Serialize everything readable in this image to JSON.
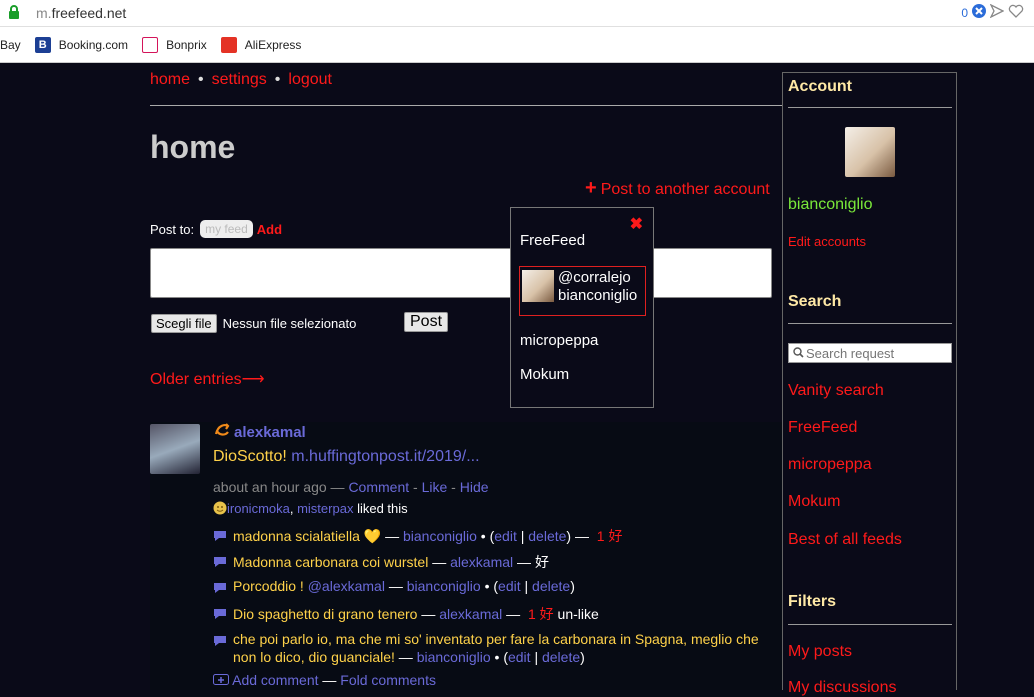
{
  "browser": {
    "url_domain": "m.freefeed.net",
    "url_prefix": "m.",
    "url_host": "freefeed.net",
    "badge_count": "0",
    "bookmarks": [
      {
        "label": "Bay",
        "color": ""
      },
      {
        "label": "Booking.com",
        "color": "#1c3f94"
      },
      {
        "label": "Bonprix",
        "color": "#d4145a"
      },
      {
        "label": "AliExpress",
        "color": "#e43225"
      }
    ]
  },
  "nav": {
    "home": "home",
    "settings": "settings",
    "logout": "logout",
    "sep": "•"
  },
  "page": {
    "title": "home",
    "post_another": "Post to another account",
    "post_to_label": "Post to:",
    "my_feed": "my feed",
    "add": "Add",
    "file_button": "Scegli file",
    "no_file": "Nessun file selezionato",
    "post_button": "Post",
    "older_entries": "Older entries⟶"
  },
  "entry": {
    "author": "alexkamal",
    "title": "DioScotto!",
    "link": "m.huffingtonpost.it/2019/...",
    "time": "about an hour ago",
    "comment": "Comment",
    "like": "Like",
    "hide": "Hide",
    "likers": [
      "ironicmoka",
      "misterpax"
    ],
    "liked_suffix": "liked this",
    "comments": [
      {
        "text": "madonna scialatiella 💛",
        "author": "bianconiglio",
        "edit": "edit",
        "delete": "delete",
        "likes": "1 好"
      },
      {
        "text": "Madonna carbonara coi wurstel",
        "author": "alexkamal",
        "suffix": "好"
      },
      {
        "text": "Porcoddio !",
        "mention": "@alexkamal",
        "author": "bianconiglio",
        "edit": "edit",
        "delete": "delete"
      },
      {
        "text": "Dio spaghetto di grano tenero",
        "author": "alexkamal",
        "likes": "1 好",
        "suffix": "un-like"
      },
      {
        "text_line1": "che poi parlo io, ma che mi so' inventato per fare la carbonara in Spagna, meglio che",
        "text_line2": "non lo dico, dio guanciale!",
        "author": "bianconiglio",
        "edit": "edit",
        "delete": "delete"
      }
    ],
    "add_comment": "Add comment",
    "fold_comments": "Fold comments"
  },
  "sidebar": {
    "account_heading": "Account",
    "account_name": "bianconiglio",
    "edit_accounts": "Edit accounts",
    "search_heading": "Search",
    "search_placeholder": "Search request",
    "links": [
      "Vanity search",
      "FreeFeed",
      "micropeppa",
      "Mokum",
      "Best of all feeds"
    ],
    "filters_heading": "Filters",
    "filter_links": [
      "My posts",
      "My discussions"
    ]
  },
  "popup": {
    "items": [
      "FreeFeed",
      "micropeppa",
      "Mokum"
    ],
    "selected_line1": "@corralejo",
    "selected_line2": "bianconiglio"
  },
  "colors": {
    "link_red": "#ff1a1a",
    "author_blue": "#6a6ad8",
    "text_yellow": "#ffd24a",
    "heading_cream": "#ffe9a6",
    "account_green": "#7ae83a"
  }
}
